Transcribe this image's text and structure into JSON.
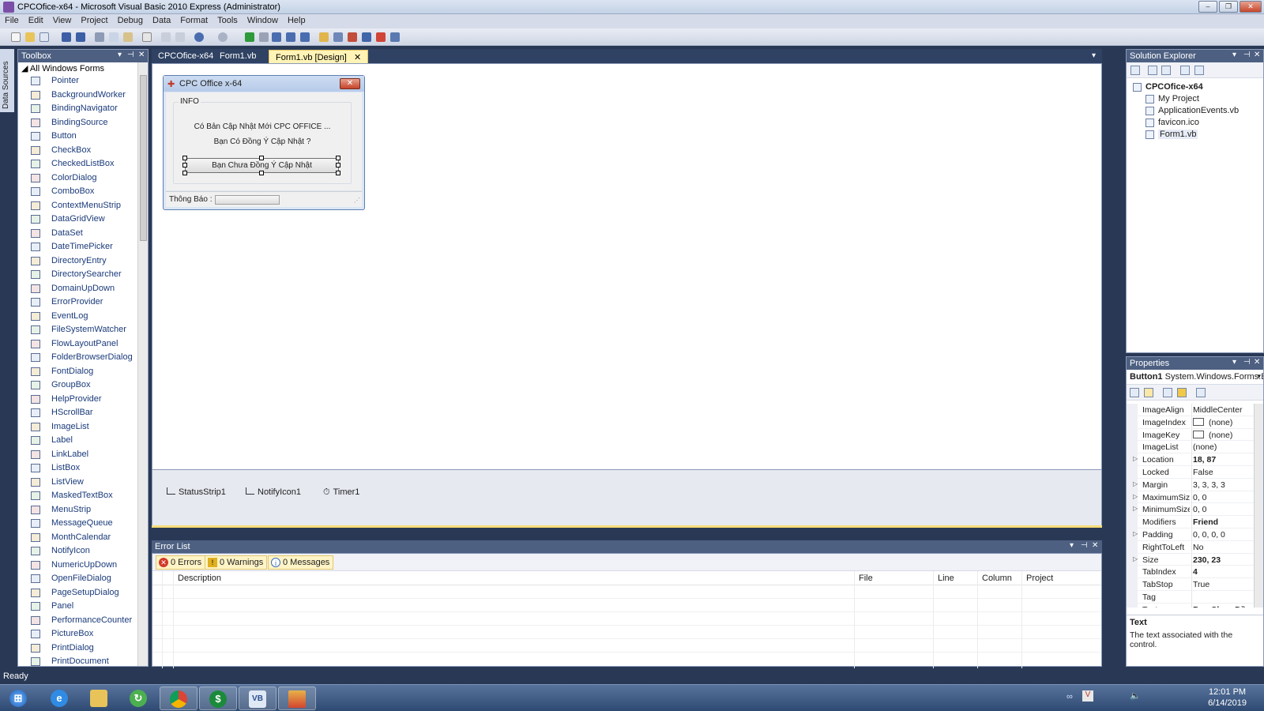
{
  "window": {
    "title": "CPCOfice-x64 - Microsoft Visual Basic 2010 Express (Administrator)"
  },
  "menu": [
    "File",
    "Edit",
    "View",
    "Project",
    "Debug",
    "Data",
    "Format",
    "Tools",
    "Window",
    "Help"
  ],
  "side_tab": "Data Sources",
  "toolbox": {
    "title": "Toolbox",
    "category": "All Windows Forms",
    "items": [
      "Pointer",
      "BackgroundWorker",
      "BindingNavigator",
      "BindingSource",
      "Button",
      "CheckBox",
      "CheckedListBox",
      "ColorDialog",
      "ComboBox",
      "ContextMenuStrip",
      "DataGridView",
      "DataSet",
      "DateTimePicker",
      "DirectoryEntry",
      "DirectorySearcher",
      "DomainUpDown",
      "ErrorProvider",
      "EventLog",
      "FileSystemWatcher",
      "FlowLayoutPanel",
      "FolderBrowserDialog",
      "FontDialog",
      "GroupBox",
      "HelpProvider",
      "HScrollBar",
      "ImageList",
      "Label",
      "LinkLabel",
      "ListBox",
      "ListView",
      "MaskedTextBox",
      "MenuStrip",
      "MessageQueue",
      "MonthCalendar",
      "NotifyIcon",
      "NumericUpDown",
      "OpenFileDialog",
      "PageSetupDialog",
      "Panel",
      "PerformanceCounter",
      "PictureBox",
      "PrintDialog",
      "PrintDocument"
    ]
  },
  "doc_tabs": [
    {
      "label": "CPCOfice-x64",
      "active": false
    },
    {
      "label": "Form1.vb",
      "active": false
    },
    {
      "label": "Form1.vb [Design]",
      "active": true
    }
  ],
  "design_form": {
    "caption": "CPC Office x-64",
    "group_label": "INFO",
    "line1": "Có Bản Cập Nhật Mới CPC OFFICE ...",
    "line2": "Bạn Có Đồng Ý Cập Nhật ?",
    "button": "Bạn Chưa Đồng Ý Cập Nhật",
    "status_label": "Thông Báo :"
  },
  "component_tray": [
    "StatusStrip1",
    "NotifyIcon1",
    "Timer1"
  ],
  "error_list": {
    "title": "Error List",
    "errors": "0 Errors",
    "warnings": "0 Warnings",
    "messages": "0 Messages",
    "columns": [
      "Description",
      "File",
      "Line",
      "Column",
      "Project"
    ]
  },
  "solution_explorer": {
    "title": "Solution Explorer",
    "project": "CPCOfice-x64",
    "items": [
      "My Project",
      "ApplicationEvents.vb",
      "favicon.ico",
      "Form1.vb"
    ]
  },
  "properties": {
    "title": "Properties",
    "object_name": "Button1",
    "object_type": "System.Windows.Forms.B",
    "rows": [
      {
        "k": "ImageAlign",
        "v": "MiddleCenter",
        "exp": false,
        "bold": false
      },
      {
        "k": "ImageIndex",
        "v": "(none)",
        "exp": false,
        "bold": false,
        "swatch": true
      },
      {
        "k": "ImageKey",
        "v": "(none)",
        "exp": false,
        "bold": false,
        "swatch": true
      },
      {
        "k": "ImageList",
        "v": "(none)",
        "exp": false,
        "bold": false
      },
      {
        "k": "Location",
        "v": "18, 87",
        "exp": true,
        "bold": true
      },
      {
        "k": "Locked",
        "v": "False",
        "exp": false,
        "bold": false
      },
      {
        "k": "Margin",
        "v": "3, 3, 3, 3",
        "exp": true,
        "bold": false
      },
      {
        "k": "MaximumSize",
        "v": "0, 0",
        "exp": true,
        "bold": false
      },
      {
        "k": "MinimumSize",
        "v": "0, 0",
        "exp": true,
        "bold": false
      },
      {
        "k": "Modifiers",
        "v": "Friend",
        "exp": false,
        "bold": true
      },
      {
        "k": "Padding",
        "v": "0, 0, 0, 0",
        "exp": true,
        "bold": false
      },
      {
        "k": "RightToLeft",
        "v": "No",
        "exp": false,
        "bold": false
      },
      {
        "k": "Size",
        "v": "230, 23",
        "exp": true,
        "bold": true
      },
      {
        "k": "TabIndex",
        "v": "4",
        "exp": false,
        "bold": true
      },
      {
        "k": "TabStop",
        "v": "True",
        "exp": false,
        "bold": false
      },
      {
        "k": "Tag",
        "v": "",
        "exp": false,
        "bold": false
      },
      {
        "k": "Text",
        "v": "Bạn Chưa Đồng",
        "exp": false,
        "bold": true
      }
    ],
    "desc_title": "Text",
    "desc_text": "The text associated with the control."
  },
  "status_bar": "Ready",
  "clock": {
    "time": "12:01 PM",
    "date": "6/14/2019"
  },
  "colors": {
    "chrome": "#293955",
    "panel_header": "#4d6082",
    "active_tab": "#fff3b6"
  }
}
